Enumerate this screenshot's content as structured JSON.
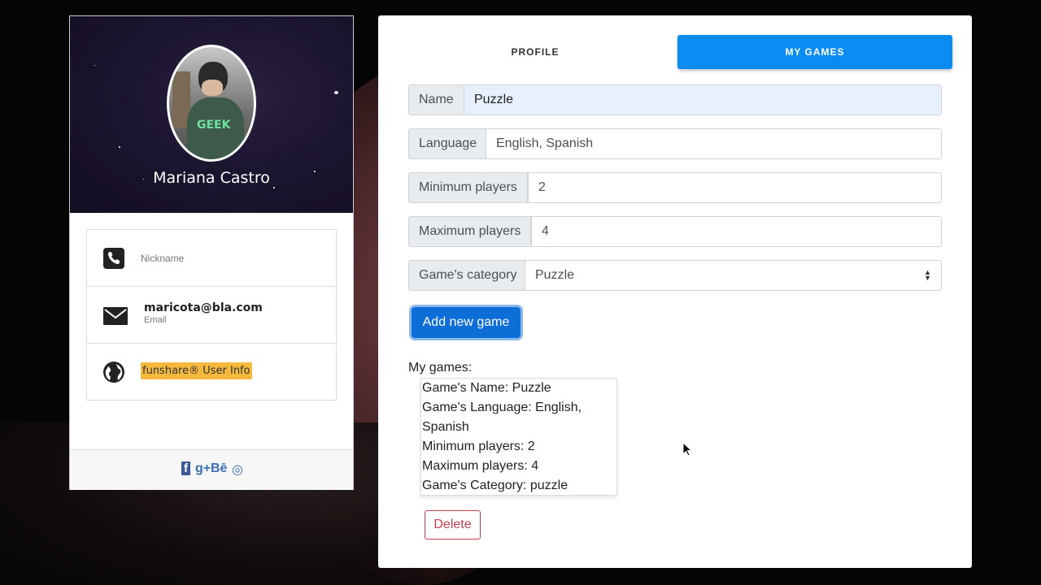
{
  "profile": {
    "name": "Mariana Castro",
    "nickname_label": "Nickname",
    "email_value": "maricota@bla.com",
    "email_label": "Email",
    "badge": "funshare® User Info"
  },
  "social": {
    "facebook": "f",
    "googleplus": "g+",
    "behance": "Bē",
    "dribbble": "◎"
  },
  "tabs": [
    {
      "label": "PROFILE",
      "active": false
    },
    {
      "label": "MY GAMES",
      "active": true
    }
  ],
  "form": {
    "name": {
      "label": "Name",
      "value": "Puzzle"
    },
    "language": {
      "label": "Language",
      "value": "English, Spanish"
    },
    "min_players": {
      "label": "Minimum players",
      "value": "2"
    },
    "max_players": {
      "label": "Maximum players",
      "value": "4"
    },
    "category": {
      "label": "Game's category",
      "value": "Puzzle"
    },
    "add_button": "Add new game"
  },
  "games": {
    "label": "My games:",
    "lines": [
      "Game's Name: Puzzle",
      "Game's Language: English,",
      "Spanish",
      "Minimum players: 2",
      "Maximum players: 4",
      "Game's Category: puzzle"
    ],
    "delete_button": "Delete"
  },
  "colors": {
    "accent": "#0a8df3",
    "primary_button": "#0d6ed8",
    "danger": "#c83e4d",
    "badge": "#f5b93e"
  }
}
